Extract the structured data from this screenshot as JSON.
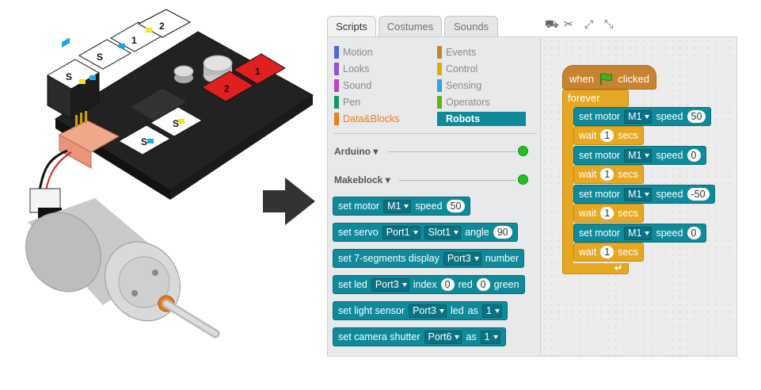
{
  "tabs": [
    "Scripts",
    "Costumes",
    "Sounds"
  ],
  "toolbar_icons": [
    "stamp-icon",
    "scissors-icon",
    "grow-icon",
    "shrink-icon"
  ],
  "categories": {
    "left": [
      {
        "label": "Motion",
        "color": "#4a6cd4"
      },
      {
        "label": "Looks",
        "color": "#8a55d7"
      },
      {
        "label": "Sound",
        "color": "#bb42c3"
      },
      {
        "label": "Pen",
        "color": "#0e9a6c"
      },
      {
        "label": "Data&Blocks",
        "color": "#ee7d16"
      }
    ],
    "right": [
      {
        "label": "Events",
        "color": "#c88330"
      },
      {
        "label": "Control",
        "color": "#e1a91a"
      },
      {
        "label": "Sensing",
        "color": "#2ca5e2"
      },
      {
        "label": "Operators",
        "color": "#5cb712"
      },
      {
        "label": "Robots",
        "color": "#0e8a9a"
      }
    ]
  },
  "sections": {
    "arduino": "Arduino",
    "makeblock": "Makeblock"
  },
  "palette_blocks": {
    "motor": {
      "a": "set motor",
      "port": "M1",
      "b": "speed",
      "val": "50"
    },
    "servo": {
      "a": "set servo",
      "port": "Port1",
      "slot": "Slot1",
      "b": "angle",
      "val": "90"
    },
    "seg": {
      "a": "set 7-segments display",
      "port": "Port3",
      "b": "number"
    },
    "led": {
      "a": "set led",
      "port": "Port3",
      "b": "index",
      "index": "0",
      "c": "red",
      "red": "0",
      "d": "green"
    },
    "light": {
      "a": "set light sensor",
      "port": "Port3",
      "b": "led",
      "c": "as",
      "val": "1"
    },
    "camera": {
      "a": "set camera shutter",
      "port": "Port6",
      "b": "as",
      "val": "1"
    }
  },
  "script": {
    "hat": {
      "when": "when",
      "clicked": "clicked"
    },
    "forever": "forever",
    "steps": [
      {
        "type": "motor",
        "a": "set motor",
        "port": "M1",
        "b": "speed",
        "val": "50"
      },
      {
        "type": "wait",
        "a": "wait",
        "val": "1",
        "b": "secs"
      },
      {
        "type": "motor",
        "a": "set motor",
        "port": "M1",
        "b": "speed",
        "val": "0"
      },
      {
        "type": "wait",
        "a": "wait",
        "val": "1",
        "b": "secs"
      },
      {
        "type": "motor",
        "a": "set motor",
        "port": "M1",
        "b": "speed",
        "val": "-50"
      },
      {
        "type": "wait",
        "a": "wait",
        "val": "1",
        "b": "secs"
      },
      {
        "type": "motor",
        "a": "set motor",
        "port": "M1",
        "b": "speed",
        "val": "0"
      },
      {
        "type": "wait",
        "a": "wait",
        "val": "1",
        "b": "secs"
      }
    ]
  },
  "board_labels": [
    "S",
    "S",
    "1",
    "2",
    "1",
    "2",
    "S",
    "S"
  ]
}
